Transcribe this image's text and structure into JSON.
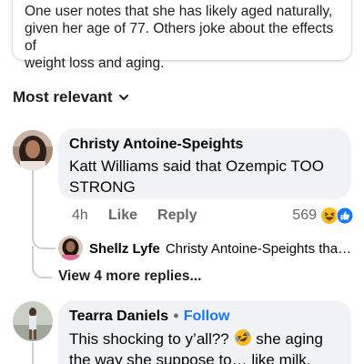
{
  "summary": {
    "lines": [
      "One user notes that she has likely aged naturally,",
      "given her age of 77. Others joke about the effects of",
      "weight loss and aging."
    ]
  },
  "sort": {
    "label": "Most relevant",
    "icon": "chevron-down-icon"
  },
  "comments": [
    {
      "author": "Christy Antoine-Speights",
      "text": "Katt Williams said that Ozempic TOO STRONG",
      "time": "4h",
      "like_label": "Like",
      "reply_label": "Reply",
      "reaction_count": "569",
      "reactions": [
        "laughing-emoji-icon",
        "like-reaction-icon"
      ],
      "reply_preview": {
        "author": "Shellz Lyfe",
        "text": "Christy Antoine-Speights that ..."
      },
      "view_more_label": "View 4 more replies..."
    },
    {
      "author": "Tearra Daniels",
      "follow_label": "Follow",
      "text_before_emoji": "This shocking to y’all??",
      "emoji": "rolling-laughing-emoji-icon",
      "text_after_emoji": "she aging the way she suppose to… like milk."
    }
  ],
  "colors": {
    "bubble": "#f0f2f5",
    "accent": "#1877f2",
    "meta": "#65676b",
    "thread_line": "#ccd0d5"
  }
}
